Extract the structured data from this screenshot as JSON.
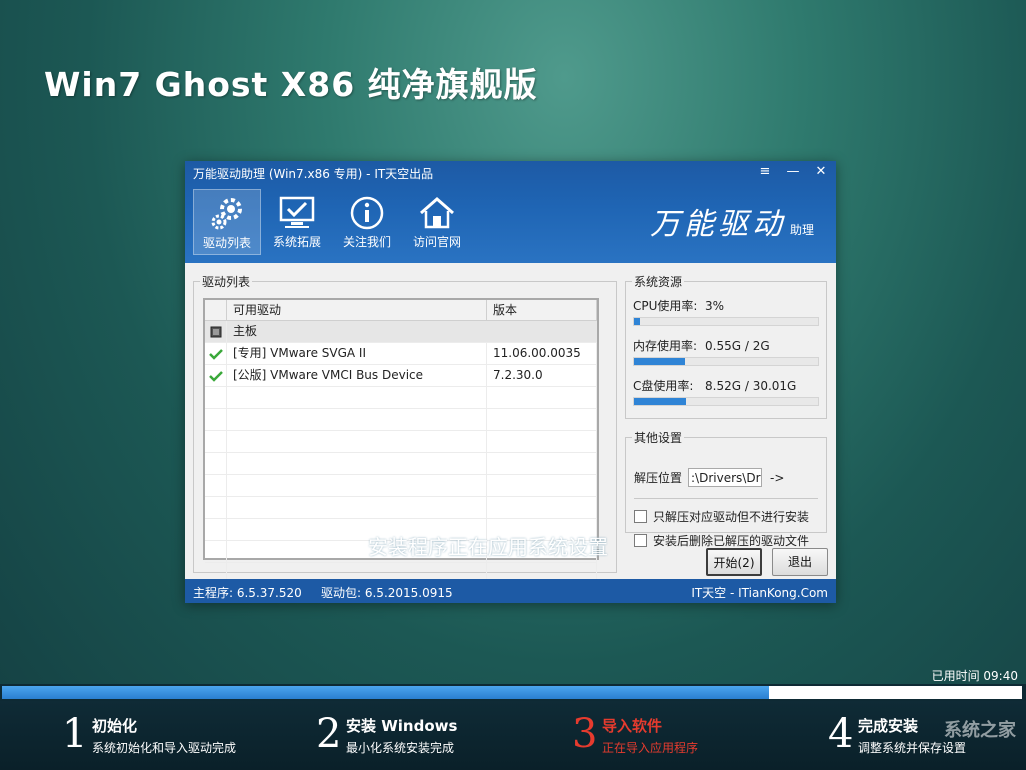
{
  "page_title": "Win7  Ghost X86  纯净旗舰版",
  "window": {
    "title": "万能驱动助理 (Win7.x86 专用) - IT天空出品",
    "controls": [
      "≡",
      "—",
      "✕"
    ],
    "nav": [
      {
        "label": "驱动列表",
        "icon": "gears-icon"
      },
      {
        "label": "系统拓展",
        "icon": "monitor-check-icon"
      },
      {
        "label": "关注我们",
        "icon": "info-icon"
      },
      {
        "label": "访问官网",
        "icon": "home-icon"
      }
    ],
    "brand_big": "万能驱动",
    "brand_small": "助理"
  },
  "driver_list": {
    "legend": "驱动列表",
    "columns": [
      "可用驱动",
      "版本"
    ],
    "group": "主板",
    "rows": [
      {
        "name": "[专用] VMware SVGA II",
        "version": "11.06.00.0035"
      },
      {
        "name": "[公版] VMware VMCI Bus Device",
        "version": "7.2.30.0"
      }
    ]
  },
  "resources": {
    "legend": "系统资源",
    "items": [
      {
        "label": "CPU使用率:",
        "value": "3%",
        "fraction": 0.03
      },
      {
        "label": "内存使用率:",
        "value": "0.55G / 2G",
        "fraction": 0.275
      },
      {
        "label": "C盘使用率:",
        "value": "8.52G / 30.01G",
        "fraction": 0.284
      }
    ]
  },
  "other": {
    "legend": "其他设置",
    "path_label": "解压位置",
    "path_value": ":\\Drivers\\Drivers",
    "path_button": "->",
    "check1": "只解压对应驱动但不进行安装",
    "check2": "安装后删除已解压的驱动文件"
  },
  "buttons": {
    "start": "开始(2)",
    "exit": "退出"
  },
  "overlay_text": "安装程序正在应用系统设置",
  "status": {
    "main": "主程序: 6.5.37.520",
    "pack": "驱动包: 6.5.2015.0915",
    "site": "IT天空 - ITianKong.Com"
  },
  "elapsed": "已用时间  09:40",
  "progress_fraction": 0.752,
  "steps": [
    {
      "num": "1",
      "title": "初始化",
      "sub": "系统初始化和导入驱动完成"
    },
    {
      "num": "2",
      "title": "安装 Windows",
      "sub": "最小化系统安装完成"
    },
    {
      "num": "3",
      "title": "导入软件",
      "sub": "正在导入应用程序"
    },
    {
      "num": "4",
      "title": "完成安装",
      "sub": "调整系统并保存设置"
    }
  ],
  "watermark": "系统之家",
  "colors": {
    "accent": "#1d5aa5",
    "current_step": "#e63b2e",
    "progress": "#2a7fd0"
  }
}
